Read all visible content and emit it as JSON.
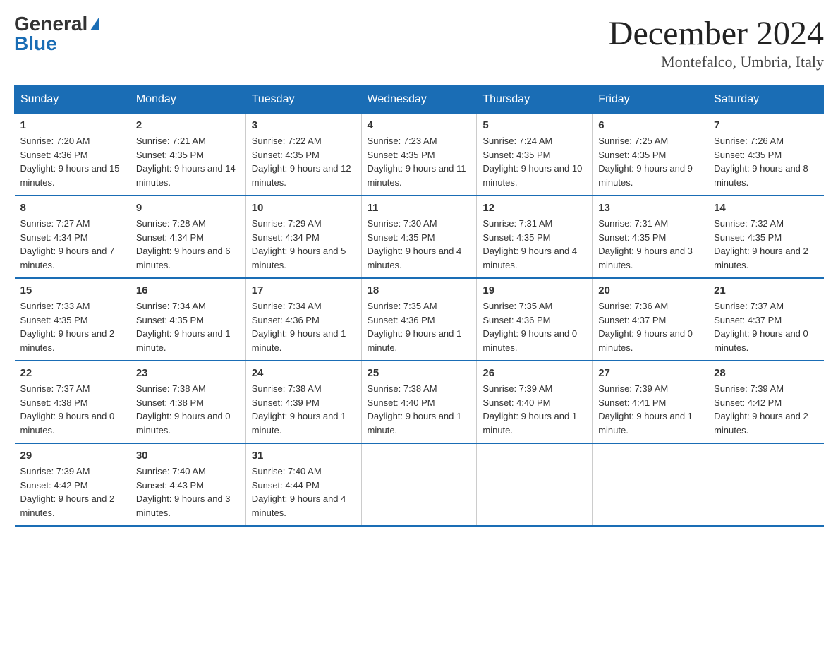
{
  "logo": {
    "general": "General",
    "blue": "Blue"
  },
  "title": "December 2024",
  "location": "Montefalco, Umbria, Italy",
  "days_of_week": [
    "Sunday",
    "Monday",
    "Tuesday",
    "Wednesday",
    "Thursday",
    "Friday",
    "Saturday"
  ],
  "weeks": [
    [
      {
        "day": "1",
        "sunrise": "7:20 AM",
        "sunset": "4:36 PM",
        "daylight": "9 hours and 15 minutes."
      },
      {
        "day": "2",
        "sunrise": "7:21 AM",
        "sunset": "4:35 PM",
        "daylight": "9 hours and 14 minutes."
      },
      {
        "day": "3",
        "sunrise": "7:22 AM",
        "sunset": "4:35 PM",
        "daylight": "9 hours and 12 minutes."
      },
      {
        "day": "4",
        "sunrise": "7:23 AM",
        "sunset": "4:35 PM",
        "daylight": "9 hours and 11 minutes."
      },
      {
        "day": "5",
        "sunrise": "7:24 AM",
        "sunset": "4:35 PM",
        "daylight": "9 hours and 10 minutes."
      },
      {
        "day": "6",
        "sunrise": "7:25 AM",
        "sunset": "4:35 PM",
        "daylight": "9 hours and 9 minutes."
      },
      {
        "day": "7",
        "sunrise": "7:26 AM",
        "sunset": "4:35 PM",
        "daylight": "9 hours and 8 minutes."
      }
    ],
    [
      {
        "day": "8",
        "sunrise": "7:27 AM",
        "sunset": "4:34 PM",
        "daylight": "9 hours and 7 minutes."
      },
      {
        "day": "9",
        "sunrise": "7:28 AM",
        "sunset": "4:34 PM",
        "daylight": "9 hours and 6 minutes."
      },
      {
        "day": "10",
        "sunrise": "7:29 AM",
        "sunset": "4:34 PM",
        "daylight": "9 hours and 5 minutes."
      },
      {
        "day": "11",
        "sunrise": "7:30 AM",
        "sunset": "4:35 PM",
        "daylight": "9 hours and 4 minutes."
      },
      {
        "day": "12",
        "sunrise": "7:31 AM",
        "sunset": "4:35 PM",
        "daylight": "9 hours and 4 minutes."
      },
      {
        "day": "13",
        "sunrise": "7:31 AM",
        "sunset": "4:35 PM",
        "daylight": "9 hours and 3 minutes."
      },
      {
        "day": "14",
        "sunrise": "7:32 AM",
        "sunset": "4:35 PM",
        "daylight": "9 hours and 2 minutes."
      }
    ],
    [
      {
        "day": "15",
        "sunrise": "7:33 AM",
        "sunset": "4:35 PM",
        "daylight": "9 hours and 2 minutes."
      },
      {
        "day": "16",
        "sunrise": "7:34 AM",
        "sunset": "4:35 PM",
        "daylight": "9 hours and 1 minute."
      },
      {
        "day": "17",
        "sunrise": "7:34 AM",
        "sunset": "4:36 PM",
        "daylight": "9 hours and 1 minute."
      },
      {
        "day": "18",
        "sunrise": "7:35 AM",
        "sunset": "4:36 PM",
        "daylight": "9 hours and 1 minute."
      },
      {
        "day": "19",
        "sunrise": "7:35 AM",
        "sunset": "4:36 PM",
        "daylight": "9 hours and 0 minutes."
      },
      {
        "day": "20",
        "sunrise": "7:36 AM",
        "sunset": "4:37 PM",
        "daylight": "9 hours and 0 minutes."
      },
      {
        "day": "21",
        "sunrise": "7:37 AM",
        "sunset": "4:37 PM",
        "daylight": "9 hours and 0 minutes."
      }
    ],
    [
      {
        "day": "22",
        "sunrise": "7:37 AM",
        "sunset": "4:38 PM",
        "daylight": "9 hours and 0 minutes."
      },
      {
        "day": "23",
        "sunrise": "7:38 AM",
        "sunset": "4:38 PM",
        "daylight": "9 hours and 0 minutes."
      },
      {
        "day": "24",
        "sunrise": "7:38 AM",
        "sunset": "4:39 PM",
        "daylight": "9 hours and 1 minute."
      },
      {
        "day": "25",
        "sunrise": "7:38 AM",
        "sunset": "4:40 PM",
        "daylight": "9 hours and 1 minute."
      },
      {
        "day": "26",
        "sunrise": "7:39 AM",
        "sunset": "4:40 PM",
        "daylight": "9 hours and 1 minute."
      },
      {
        "day": "27",
        "sunrise": "7:39 AM",
        "sunset": "4:41 PM",
        "daylight": "9 hours and 1 minute."
      },
      {
        "day": "28",
        "sunrise": "7:39 AM",
        "sunset": "4:42 PM",
        "daylight": "9 hours and 2 minutes."
      }
    ],
    [
      {
        "day": "29",
        "sunrise": "7:39 AM",
        "sunset": "4:42 PM",
        "daylight": "9 hours and 2 minutes."
      },
      {
        "day": "30",
        "sunrise": "7:40 AM",
        "sunset": "4:43 PM",
        "daylight": "9 hours and 3 minutes."
      },
      {
        "day": "31",
        "sunrise": "7:40 AM",
        "sunset": "4:44 PM",
        "daylight": "9 hours and 4 minutes."
      },
      null,
      null,
      null,
      null
    ]
  ],
  "labels": {
    "sunrise": "Sunrise:",
    "sunset": "Sunset:",
    "daylight": "Daylight:"
  }
}
